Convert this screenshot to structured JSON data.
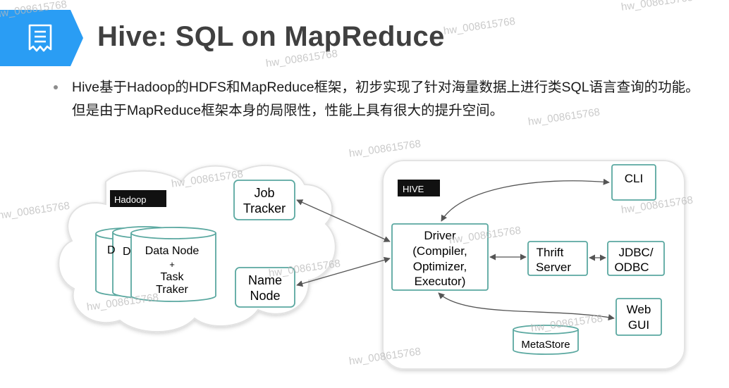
{
  "title": "Hive: SQL on MapReduce",
  "intro": "Hive基于Hadoop的HDFS和MapReduce框架，初步实现了针对海量数据上进行类SQL语言查询的功能。但是由于MapReduce框架本身的局限性，性能上具有很大的提升空间。",
  "watermark": "hw_008615768",
  "colors": {
    "header_blue": "#2a9df4",
    "box_border": "#5aa8a0",
    "arrow": "#555555",
    "label_bg": "#111111"
  },
  "diagram": {
    "hadoop": {
      "label": "Hadoop",
      "node_stack": {
        "back_labels": [
          "D",
          "D"
        ],
        "front_line1": "Data Node",
        "front_line2": "+",
        "front_line3": "Task",
        "front_line4": "Traker"
      },
      "job_tracker": {
        "line1": "Job",
        "line2": "Tracker"
      },
      "name_node": {
        "line1": "Name",
        "line2": "Node"
      }
    },
    "hive": {
      "label": "HIVE",
      "driver": {
        "line1": "Driver",
        "line2": "(Compiler,",
        "line3": "Optimizer,",
        "line4": "Executor)"
      },
      "cli": "CLI",
      "thrift_server": {
        "line1": "Thrift",
        "line2": "Server"
      },
      "jdbc_odbc": {
        "line1": "JDBC/",
        "line2": "ODBC"
      },
      "web_gui": {
        "line1": "Web",
        "line2": "GUI"
      },
      "metastore": "MetaStore"
    }
  }
}
